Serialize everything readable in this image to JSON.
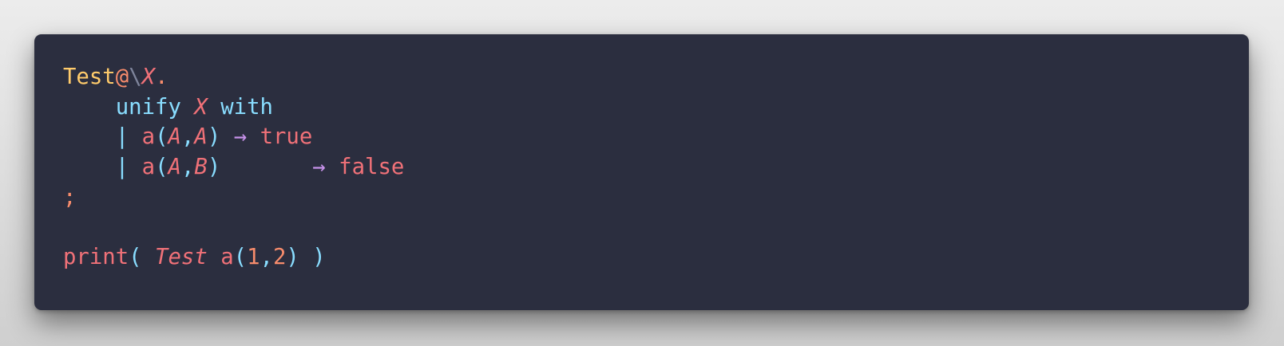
{
  "code": {
    "lines": [
      {
        "tokens": [
          {
            "text": "Test",
            "kind": "type-name",
            "color": "#ffcb6b"
          },
          {
            "text": "@",
            "kind": "operator",
            "color": "#f78c6c"
          },
          {
            "text": "\\",
            "kind": "lambda",
            "color": "#7f859c"
          },
          {
            "text": "X",
            "kind": "variable",
            "color": "#f07178"
          },
          {
            "text": ".",
            "kind": "punctuation",
            "color": "#f78c6c"
          }
        ]
      },
      {
        "tokens": [
          {
            "text": "    ",
            "kind": "indent"
          },
          {
            "text": "unify",
            "kind": "keyword",
            "color": "#89ddff"
          },
          {
            "text": " ",
            "kind": "space"
          },
          {
            "text": "X",
            "kind": "variable",
            "color": "#f07178"
          },
          {
            "text": " ",
            "kind": "space"
          },
          {
            "text": "with",
            "kind": "keyword",
            "color": "#89ddff"
          }
        ]
      },
      {
        "tokens": [
          {
            "text": "    ",
            "kind": "indent"
          },
          {
            "text": "|",
            "kind": "pipe",
            "color": "#89ddff"
          },
          {
            "text": " ",
            "kind": "space"
          },
          {
            "text": "a",
            "kind": "functor",
            "color": "#f07178"
          },
          {
            "text": "(",
            "kind": "paren",
            "color": "#89ddff"
          },
          {
            "text": "A",
            "kind": "variable",
            "color": "#f07178"
          },
          {
            "text": ",",
            "kind": "comma",
            "color": "#89ddff"
          },
          {
            "text": "A",
            "kind": "variable",
            "color": "#f07178"
          },
          {
            "text": ")",
            "kind": "paren",
            "color": "#89ddff"
          },
          {
            "text": " ",
            "kind": "space"
          },
          {
            "text": "→",
            "kind": "arrow",
            "color": "#c792ea"
          },
          {
            "text": " ",
            "kind": "space"
          },
          {
            "text": "true",
            "kind": "atom",
            "color": "#f07178"
          }
        ]
      },
      {
        "tokens": [
          {
            "text": "    ",
            "kind": "indent"
          },
          {
            "text": "|",
            "kind": "pipe",
            "color": "#89ddff"
          },
          {
            "text": " ",
            "kind": "space"
          },
          {
            "text": "a",
            "kind": "functor",
            "color": "#f07178"
          },
          {
            "text": "(",
            "kind": "paren",
            "color": "#89ddff"
          },
          {
            "text": "A",
            "kind": "variable",
            "color": "#f07178"
          },
          {
            "text": ",",
            "kind": "comma",
            "color": "#89ddff"
          },
          {
            "text": "B",
            "kind": "variable",
            "color": "#f07178"
          },
          {
            "text": ")",
            "kind": "paren",
            "color": "#89ddff"
          },
          {
            "text": "       ",
            "kind": "space"
          },
          {
            "text": "→",
            "kind": "arrow",
            "color": "#c792ea"
          },
          {
            "text": " ",
            "kind": "space"
          },
          {
            "text": "false",
            "kind": "atom",
            "color": "#f07178"
          }
        ]
      },
      {
        "tokens": [
          {
            "text": ";",
            "kind": "terminator",
            "color": "#f78c6c"
          }
        ]
      },
      {
        "tokens": []
      },
      {
        "tokens": [
          {
            "text": "print",
            "kind": "builtin",
            "color": "#f07178"
          },
          {
            "text": "(",
            "kind": "paren",
            "color": "#89ddff"
          },
          {
            "text": " ",
            "kind": "space"
          },
          {
            "text": "Test",
            "kind": "variable",
            "color": "#f07178"
          },
          {
            "text": " ",
            "kind": "space"
          },
          {
            "text": "a",
            "kind": "functor",
            "color": "#f07178"
          },
          {
            "text": "(",
            "kind": "paren",
            "color": "#89ddff"
          },
          {
            "text": "1",
            "kind": "number",
            "color": "#f78c6c"
          },
          {
            "text": ",",
            "kind": "comma",
            "color": "#89ddff"
          },
          {
            "text": "2",
            "kind": "number",
            "color": "#f78c6c"
          },
          {
            "text": ")",
            "kind": "paren",
            "color": "#89ddff"
          },
          {
            "text": " ",
            "kind": "space"
          },
          {
            "text": ")",
            "kind": "paren",
            "color": "#89ddff"
          }
        ]
      }
    ]
  },
  "theme": {
    "background": "#2b2e3f"
  }
}
